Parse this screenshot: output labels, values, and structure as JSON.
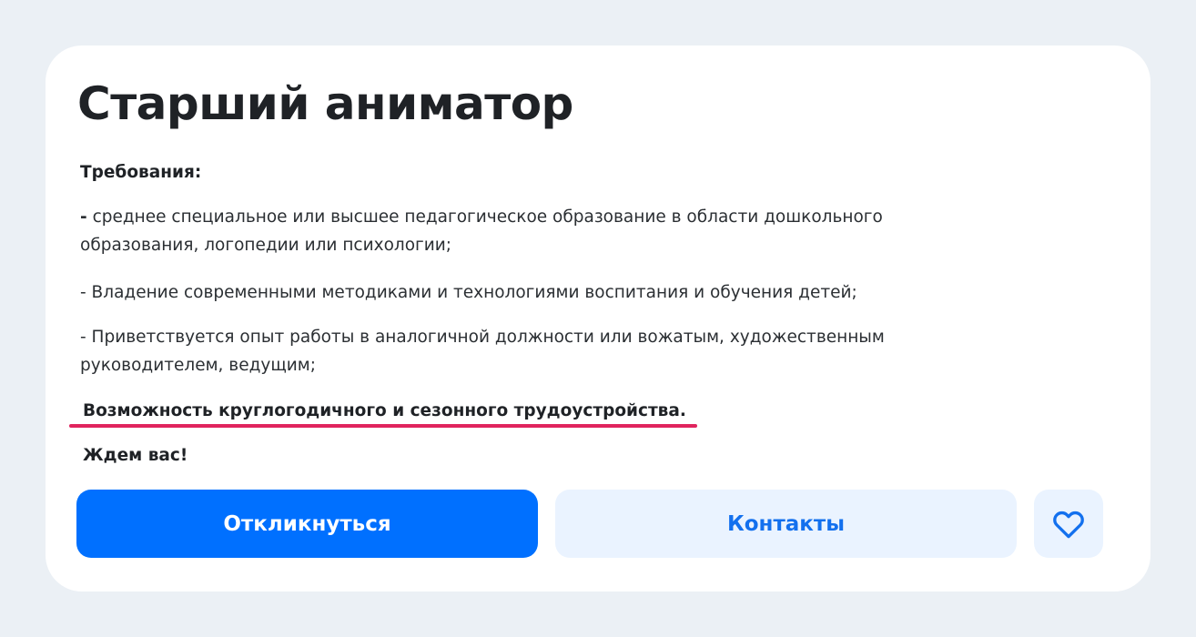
{
  "vacancy": {
    "title": "Старший аниматор",
    "requirements_label": "Требования:",
    "items": [
      {
        "bullet": "-",
        "lines": [
          " среднее специальное или высшее педагогическое образование в области дошкольного",
          "образования, логопедии или психологии;"
        ]
      },
      {
        "lines": [
          "- Владение современными методиками и технологиями воспитания и обучения детей;"
        ]
      },
      {
        "lines": [
          "- Приветствуется опыт работы в аналогичной должности или вожатым, художественным",
          "руководителем, ведущим;"
        ]
      }
    ],
    "highlight": "Возможность круглогодичного и сезонного трудоустройства.",
    "closing": "Ждем вас!"
  },
  "actions": {
    "apply_label": "Откликнуться",
    "contacts_label": "Контакты",
    "favorite_icon": "heart-icon"
  },
  "colors": {
    "primary": "#0070ff",
    "secondary_bg": "#eaf3ff",
    "secondary_text": "#1370ee",
    "highlight_underline": "#e0245e",
    "page_background": "#ebf0f5"
  }
}
